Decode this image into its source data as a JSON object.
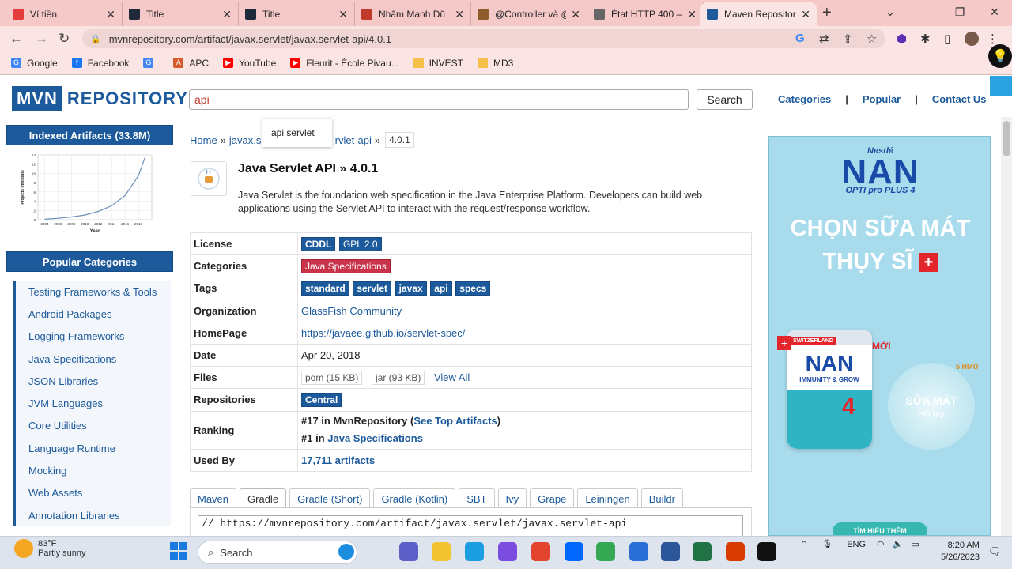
{
  "browser": {
    "tabs": [
      {
        "title": "Ví tiền",
        "icon": "r-icon",
        "color": "#e23c3c"
      },
      {
        "title": "Title",
        "icon": "ws-icon",
        "color": "#1e2a3a"
      },
      {
        "title": "Title",
        "icon": "ws-icon",
        "color": "#1e2a3a"
      },
      {
        "title": "Nhâm Mạnh Dũ",
        "icon": "document-icon",
        "color": "#c0392b"
      },
      {
        "title": "@Controller và @",
        "icon": "v-icon",
        "color": "#8e5b2a"
      },
      {
        "title": "État HTTP 400 – I",
        "icon": "globe-icon",
        "color": "#666666"
      },
      {
        "title": "Maven Repositor",
        "icon": "mvn-icon",
        "color": "#1c5a9c"
      }
    ],
    "url": "mvnrepository.com/artifact/javax.servlet/javax.servlet-api/4.0.1",
    "bookmarks": [
      {
        "label": "Google",
        "color": "#4285f4",
        "glyph": "G"
      },
      {
        "label": "Facebook",
        "color": "#1877f2",
        "glyph": "f"
      },
      {
        "label": "",
        "color": "#4285f4",
        "glyph": "G"
      },
      {
        "label": "APC",
        "color": "#d65c2b",
        "glyph": "A"
      },
      {
        "label": "YouTube",
        "color": "#ff0000",
        "glyph": "▶"
      },
      {
        "label": "Fleurit - École Pivau...",
        "color": "#ff0000",
        "glyph": "▶"
      },
      {
        "label": "INVEST",
        "color": "#f5c04a",
        "glyph": ""
      },
      {
        "label": "MD3",
        "color": "#f5c04a",
        "glyph": ""
      }
    ]
  },
  "site": {
    "logo_mvn": "MVN",
    "logo_repo": "REPOSITORY",
    "search_value": "api",
    "search_button": "Search",
    "autocomplete": "api servlet",
    "nav": [
      "Categories",
      "Popular",
      "Contact Us"
    ]
  },
  "sidebar": {
    "indexed_title": "Indexed Artifacts (33.8M)",
    "chart_ylabel": "Projects (millions)",
    "chart_xlabel": "Year",
    "popular_title": "Popular Categories",
    "categories": [
      "Testing Frameworks & Tools",
      "Android Packages",
      "Logging Frameworks",
      "Java Specifications",
      "JSON Libraries",
      "JVM Languages",
      "Core Utilities",
      "Language Runtime",
      "Mocking",
      "Web Assets",
      "Annotation Libraries"
    ]
  },
  "chart_data": {
    "type": "line",
    "x": [
      2004,
      2006,
      2008,
      2010,
      2012,
      2014,
      2016,
      2018,
      2019
    ],
    "values": [
      0.1,
      0.3,
      0.6,
      1.0,
      1.8,
      3.0,
      5.2,
      9.5,
      13.5
    ],
    "xticks": [
      "2004",
      "2006",
      "2008",
      "2010",
      "2012",
      "2014",
      "2016",
      "2018"
    ],
    "yticks": [
      "0",
      "2",
      "4",
      "6",
      "8",
      "10",
      "12",
      "14"
    ],
    "ylim": [
      0,
      14
    ],
    "xlabel": "Year",
    "ylabel": "Projects (millions)",
    "grid": true
  },
  "artifact": {
    "crumb_home": "Home",
    "crumb_group": "javax.se",
    "crumb_artifact": "rvlet-api",
    "crumb_sep": "»",
    "crumb_version": "4.0.1",
    "title": "Java Servlet API » 4.0.1",
    "description": "Java Servlet is the foundation web specification in the Java Enterprise Platform. Developers can build web applications using the Servlet API to interact with the request/response workflow.",
    "labels": {
      "license": "License",
      "categories": "Categories",
      "tags": "Tags",
      "organization": "Organization",
      "homepage": "HomePage",
      "date": "Date",
      "files": "Files",
      "repositories": "Repositories",
      "ranking": "Ranking",
      "used_by": "Used By"
    },
    "licenses": [
      "CDDL",
      "GPL 2.0"
    ],
    "category": "Java Specifications",
    "tags": [
      "standard",
      "servlet",
      "javax",
      "api",
      "specs"
    ],
    "organization": "GlassFish Community",
    "homepage": "https://javaee.github.io/servlet-spec/",
    "date": "Apr 20, 2018",
    "files": [
      "pom (15 KB)",
      "jar (93 KB)"
    ],
    "files_view_all": "View All",
    "repository": "Central",
    "ranking1_prefix": "#17 in MvnRepository (",
    "ranking1_link": "See Top Artifacts",
    "ranking1_suffix": ")",
    "ranking2_prefix": "#1 in ",
    "ranking2_link": "Java Specifications",
    "used_by": "17,711 artifacts"
  },
  "build_tabs": [
    "Maven",
    "Gradle",
    "Gradle (Short)",
    "Gradle (Kotlin)",
    "SBT",
    "Ivy",
    "Grape",
    "Leiningen",
    "Buildr"
  ],
  "code_line": "// https://mvnrepository.com/artifact/javax.servlet/javax.servlet-api",
  "ad": {
    "brand": "Nestlé",
    "product": "NAN",
    "subline": "OPTI pro PLUS 4",
    "headline1": "CHỌN SỮA MÁT",
    "headline2": "THỤY SĨ",
    "badge_new": "MỚI",
    "swiss_label": "SWITZERLAND",
    "can_sub": "IMMUNITY & GROW",
    "milk_text": "SỮA MÁT",
    "milk_sub": "Hỗ trợ",
    "cta": "TÌM HIỂU THÊM",
    "hmo": "5 HMO"
  },
  "taskbar": {
    "temp": "83°F",
    "weather": "Partly sunny",
    "search": "Search",
    "lang": "ENG",
    "time": "8:20 AM",
    "date": "5/26/2023"
  }
}
